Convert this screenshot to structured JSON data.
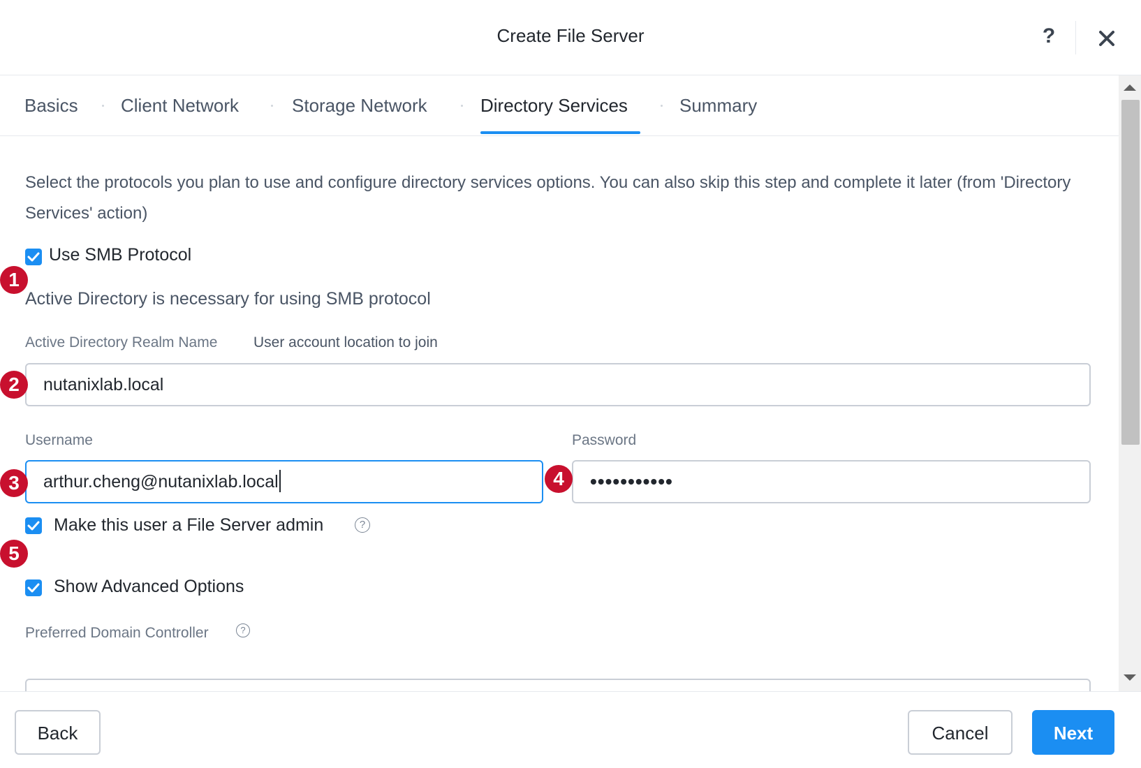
{
  "dialog": {
    "title": "Create File Server",
    "help_label": "?"
  },
  "tabs": [
    {
      "label": "Basics"
    },
    {
      "label": "Client Network"
    },
    {
      "label": "Storage Network"
    },
    {
      "label": "Directory Services",
      "active": true
    },
    {
      "label": "Summary"
    }
  ],
  "intro": "Select the protocols you plan to use and configure directory services options. You can also skip this step and complete it later (from 'Directory Services' action)",
  "smb": {
    "label": "Use SMB Protocol",
    "checked": true
  },
  "ad_note": "Active Directory is necessary for using SMB protocol",
  "realm": {
    "label": "Active Directory Realm Name",
    "secondary_label": "User account location to join",
    "value": "nutanixlab.local"
  },
  "username": {
    "label": "Username",
    "value": "arthur.cheng@nutanixlab.local"
  },
  "password": {
    "label": "Password",
    "value": "•••••••••••"
  },
  "admin": {
    "label": "Make this user a File Server admin",
    "checked": true
  },
  "advanced": {
    "label": "Show Advanced Options",
    "checked": true
  },
  "preferred_dc": {
    "label": "Preferred Domain Controller"
  },
  "markers": [
    "1",
    "2",
    "3",
    "4",
    "5"
  ],
  "footer": {
    "back": "Back",
    "cancel": "Cancel",
    "next": "Next"
  },
  "colors": {
    "accent": "#1b8ef2",
    "marker": "#c8102e",
    "border": "#c9ced6"
  }
}
